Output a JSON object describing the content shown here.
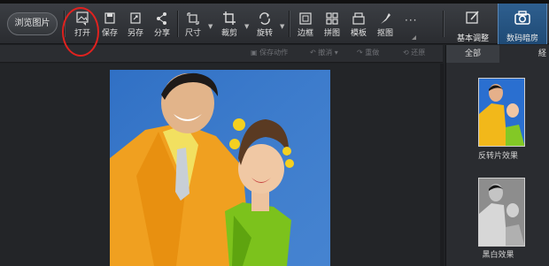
{
  "toolbar": {
    "browse_label": "浏览图片",
    "tools": [
      {
        "label": "打开",
        "icon": "open-image-icon"
      },
      {
        "label": "保存",
        "icon": "save-icon"
      },
      {
        "label": "另存",
        "icon": "save-as-icon"
      },
      {
        "label": "分享",
        "icon": "share-icon"
      },
      {
        "label": "尺寸",
        "icon": "resize-icon"
      },
      {
        "label": "裁剪",
        "icon": "crop-icon"
      },
      {
        "label": "旋转",
        "icon": "rotate-icon"
      },
      {
        "label": "边框",
        "icon": "border-icon"
      },
      {
        "label": "拼图",
        "icon": "collage-icon"
      },
      {
        "label": "模板",
        "icon": "template-icon"
      },
      {
        "label": "抠图",
        "icon": "cutout-icon"
      }
    ],
    "more_label": "···"
  },
  "right_tabs": [
    {
      "label": "基本调整",
      "icon": "adjust-icon",
      "active": false
    },
    {
      "label": "数码暗房",
      "icon": "camera-icon",
      "active": true
    }
  ],
  "subbar": {
    "save_action": "保存动作",
    "undo": "撤消",
    "redo": "重做",
    "restore": "还原"
  },
  "panel": {
    "tabs": [
      "全部",
      "経"
    ],
    "effects": [
      {
        "label": "反转片效果",
        "style": "color"
      },
      {
        "label": "黑白效果",
        "style": "bw"
      }
    ]
  }
}
